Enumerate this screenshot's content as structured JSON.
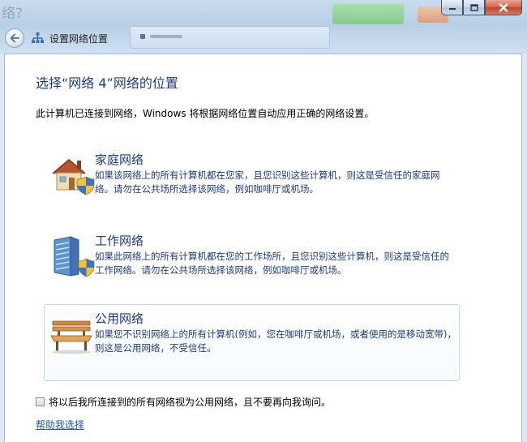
{
  "background": {
    "ghost_text": "络?"
  },
  "window": {
    "title": "设置网络位置",
    "controls": {
      "minimize": "minimize",
      "maximize": "maximize",
      "close": "close"
    }
  },
  "page": {
    "heading": "选择“网络  4”网络的位置",
    "description": "此计算机已连接到网络，Windows 将根据网络位置自动应用正确的网络设置。"
  },
  "options": [
    {
      "title": "家庭网络",
      "description": "如果该网络上的所有计算机都在您家，且您识别这些计算机，则这是受信任的家庭网络。请勿在公共场所选择该网络，例如咖啡厅或机场。",
      "icon": "house-shield-icon"
    },
    {
      "title": "工作网络",
      "description": "如果此网络上的所有计算机都在您的工作场所，且您识别这些计算机，则这是受信任的工作网络。请勿在公共场所选择该网络，例如咖啡厅或机场。",
      "icon": "office-building-shield-icon"
    },
    {
      "title": "公用网络",
      "description": "如果您不识别网络上的所有计算机(例如，您在咖啡厅或机场，或者使用的是移动宽带)，则这是公用网络，不受信任。",
      "icon": "park-bench-icon",
      "selected": true
    }
  ],
  "checkbox": {
    "label": "将以后我所连接到的所有网络视为公用网络，且不要再向我询问。",
    "checked": false
  },
  "help_link": "帮助我选择",
  "colors": {
    "heading": "#1c3a8a",
    "link": "#1f56c7",
    "selected_border": "#b5dcef",
    "close_button": "#c7432b"
  }
}
